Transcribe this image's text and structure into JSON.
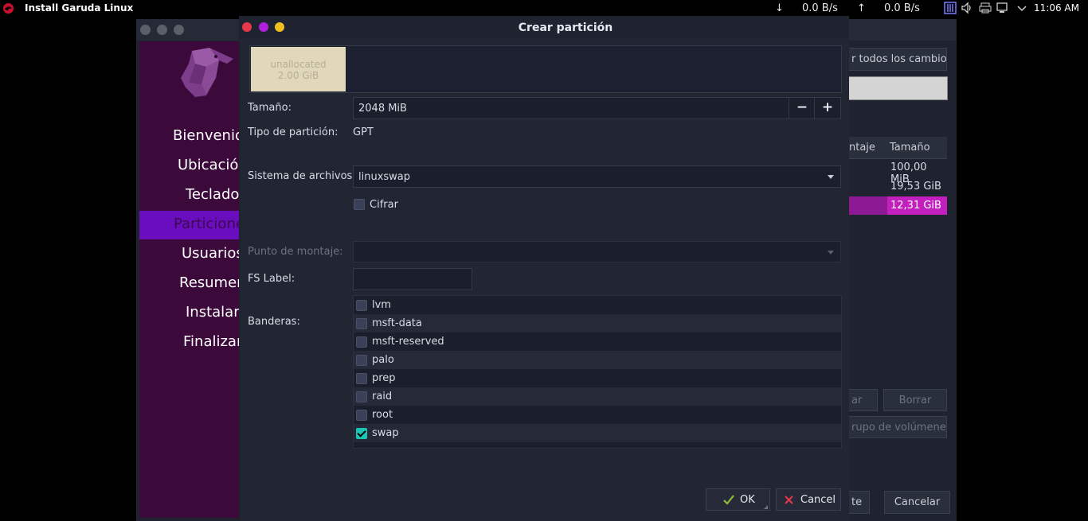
{
  "topbar": {
    "app_title": "Install Garuda Linux",
    "download_rate": "0.0 B/s",
    "upload_rate": "0.0 B/s",
    "clock": "11:06 AM"
  },
  "sidebar": {
    "items": [
      {
        "label": "Bienvenido"
      },
      {
        "label": "Ubicación"
      },
      {
        "label": "Teclado"
      },
      {
        "label": "Particiones"
      },
      {
        "label": "Usuarios"
      },
      {
        "label": "Resumen"
      },
      {
        "label": "Instalar"
      },
      {
        "label": "Finalizar"
      }
    ],
    "active_index": 3
  },
  "background": {
    "revert_label": "r todos los cambios",
    "col_mount": "ntaje",
    "col_size": "Tamaño",
    "sizes": [
      "100,00 MiB",
      "19,53 GiB",
      "12,31 GiB"
    ],
    "edit_label": "ar",
    "delete_label": "Borrar",
    "volume_group_label": "rupo de volúmenes",
    "back_label": "te",
    "cancel_label": "Cancelar"
  },
  "dialog": {
    "title": "Crear partición",
    "unallocated": {
      "name": "unallocated",
      "size": "2.00 GiB"
    },
    "size_label": "Tamaño:",
    "size_value": "2048 MiB",
    "minus": "−",
    "plus": "+",
    "partition_type_label": "Tipo de partición:",
    "partition_type_value": "GPT",
    "filesystem_label": "Sistema de archivos:",
    "filesystem_value": "linuxswap",
    "encrypt_label": "Cifrar",
    "mount_point_label": "Punto de montaje:",
    "fs_label_label": "FS Label:",
    "flags_label": "Banderas:",
    "flags": [
      {
        "label": "lvm",
        "checked": false
      },
      {
        "label": "msft-data",
        "checked": false
      },
      {
        "label": "msft-reserved",
        "checked": false
      },
      {
        "label": "palo",
        "checked": false
      },
      {
        "label": "prep",
        "checked": false
      },
      {
        "label": "raid",
        "checked": false
      },
      {
        "label": "root",
        "checked": false
      },
      {
        "label": "swap",
        "checked": true
      }
    ],
    "ok_label": "OK",
    "cancel_label": "Cancel"
  },
  "colors": {
    "sidebar_bg": "#3b0a3b",
    "sidebar_active": "#6a0dbf",
    "selected_row": "#b01fb5",
    "checkbox_checked": "#19c5b3",
    "close_btn": "#e8384c",
    "min_btn": "#b01fe0",
    "max_btn": "#f0c020"
  }
}
